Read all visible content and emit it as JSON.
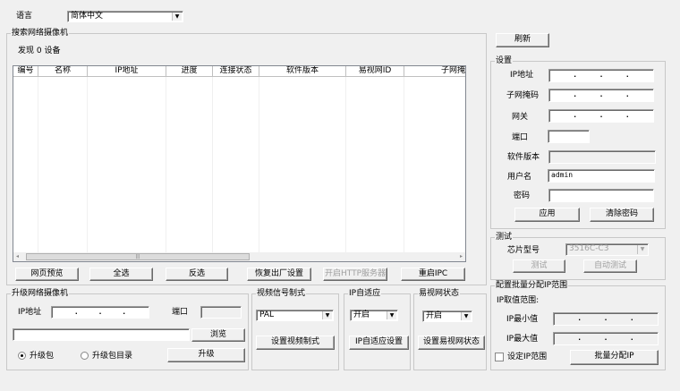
{
  "language": {
    "label": "语言",
    "value": "简体中文"
  },
  "search": {
    "title": "搜索网络摄像机",
    "found": "发现 0 设备",
    "columns": [
      "编号",
      "名称",
      "IP地址",
      "进度",
      "连接状态",
      "软件版本",
      "易视网ID",
      "子网掩码"
    ],
    "buttons": {
      "preview": "网页预览",
      "select_all": "全选",
      "invert": "反选",
      "factory_reset": "恢复出厂设置",
      "http_server": "开启HTTP服务器",
      "reboot": "重启IPC"
    }
  },
  "upgrade": {
    "title": "升级网络摄像机",
    "ip_label": "IP地址",
    "ip_value": ". . .",
    "port_label": "端口",
    "port_value": "",
    "file_path": "",
    "browse": "浏览",
    "radio_package": "升级包",
    "radio_dir": "升级包目录",
    "upgrade_btn": "升级",
    "selected": "升级包"
  },
  "video": {
    "title": "视频信号制式",
    "value": "PAL",
    "button": "设置视频制式"
  },
  "ipadapt": {
    "title": "IP自适应",
    "value": "开启",
    "button": "IP自适应设置"
  },
  "esee": {
    "title": "易视网状态",
    "value": "开启",
    "button": "设置易视网状态"
  },
  "refresh": "刷新",
  "settings": {
    "title": "设置",
    "ip": "IP地址",
    "mask": "子网掩码",
    "gateway": "网关",
    "port": "端口",
    "version": "软件版本",
    "username": "用户名",
    "username_value": "admin",
    "password": "密码",
    "password_value": "",
    "apply": "应用",
    "clear_pwd": "清除密码"
  },
  "test": {
    "title": "测试",
    "chip_label": "芯片型号",
    "chip_value": "3516C-C3",
    "test_btn": "测试",
    "auto_test_btn": "自动测试"
  },
  "batch": {
    "title": "配置批量分配IP范围",
    "range_label": "IP取值范围:",
    "min_label": "IP最小值",
    "max_label": "IP最大值",
    "set_range": "设定IP范围",
    "set_range_checked": false,
    "assign_btn": "批量分配IP"
  }
}
